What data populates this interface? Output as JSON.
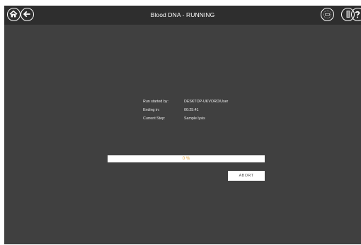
{
  "header": {
    "title": "Blood DNA - RUNNING",
    "left_icons": [
      "home-icon",
      "back-arrow-icon"
    ],
    "right_icons": [
      "instrument-status-icon",
      "door-lock-icon",
      "help-icon"
    ]
  },
  "run_info": {
    "started_by_label": "Run started by:",
    "started_by_value": "DESKTOP-UKVORD\\User",
    "ending_label": "Ending in:",
    "ending_value": "00:25:41",
    "step_label": "Current Step:",
    "step_value": "Sample lysis"
  },
  "progress": {
    "percent": 0,
    "text": "0 %"
  },
  "actions": {
    "abort_label": "ABORT"
  },
  "colors": {
    "background": "#404040",
    "titlebar": "#2e2e2e",
    "accent": "#e4a23a",
    "text": "#ececec"
  }
}
